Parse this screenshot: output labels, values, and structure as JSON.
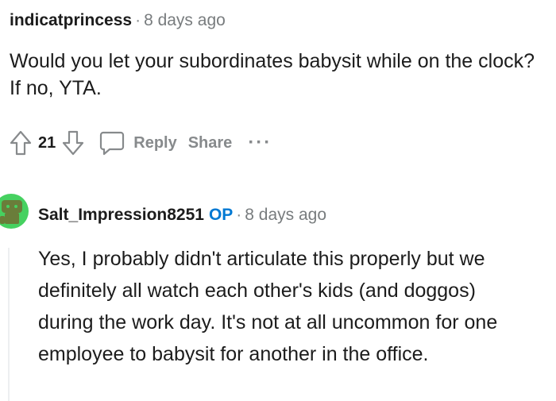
{
  "comment1": {
    "author": "indicatprincess",
    "separator": "·",
    "time": "8 days ago",
    "body": "Would you let your subordinates babysit while on the clock? If no, YTA.",
    "score": "21",
    "reply_label": "Reply",
    "share_label": "Share",
    "more_label": "···"
  },
  "comment2": {
    "author": "Salt_Impression8251",
    "op_badge": "OP",
    "separator": "·",
    "time": "8 days ago",
    "body": "Yes, I probably didn't articulate this properly but we definitely all watch each other's kids (and doggos) during the work day. It's not at all uncommon for one employee to babysit for another in the office."
  },
  "colors": {
    "op_badge": "#0079d3",
    "muted_text": "#878a8c",
    "avatar_bg": "#46d160"
  },
  "icons": [
    "upvote-icon",
    "downvote-icon",
    "comment-bubble-icon",
    "more-dots-icon"
  ]
}
